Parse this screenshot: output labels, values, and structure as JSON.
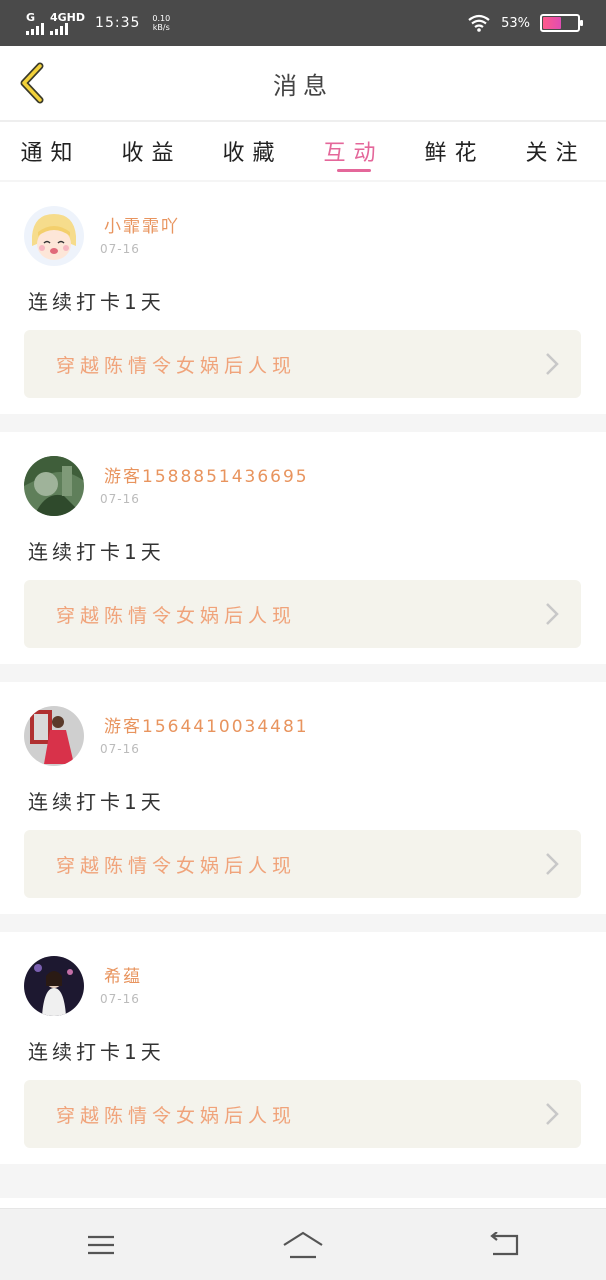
{
  "status_bar": {
    "signal1_label": "G",
    "signal2_label": "4GHD",
    "time": "15:35",
    "speed_value": "0.10",
    "speed_unit": "kB/s",
    "battery_percent": "53%",
    "battery_level": 0.53,
    "icons": [
      "signal-icon",
      "signal-icon",
      "wifi-icon",
      "battery-icon"
    ]
  },
  "header": {
    "title": "消息",
    "back_icon": "back-chevron-icon",
    "accent_color": "#e4679a"
  },
  "tabs": [
    {
      "label": "通知",
      "active": false
    },
    {
      "label": "收益",
      "active": false
    },
    {
      "label": "收藏",
      "active": false
    },
    {
      "label": "互动",
      "active": true
    },
    {
      "label": "鲜花",
      "active": false
    },
    {
      "label": "关注",
      "active": false
    }
  ],
  "feed": [
    {
      "username": "小霏霏吖",
      "date": "07-16",
      "message": "连续打卡1天",
      "link_title": "穿越陈情令女娲后人现",
      "avatar": "anime-girl-avatar"
    },
    {
      "username": "游客15888514366​95",
      "date": "07-16",
      "message": "连续打卡1天",
      "link_title": "穿越陈情令女娲后人现",
      "avatar": "green-photo-avatar"
    },
    {
      "username": "游客15644100344​81",
      "date": "07-16",
      "message": "连续打卡1天",
      "link_title": "穿越陈情令女娲后人现",
      "avatar": "red-dress-avatar"
    },
    {
      "username": "希蕴",
      "date": "07-16",
      "message": "连续打卡1天",
      "link_title": "穿越陈情令女娲后人现",
      "avatar": "night-photo-avatar"
    }
  ],
  "navbar": {
    "icons": [
      "menu-icon",
      "home-icon",
      "back-icon"
    ]
  }
}
